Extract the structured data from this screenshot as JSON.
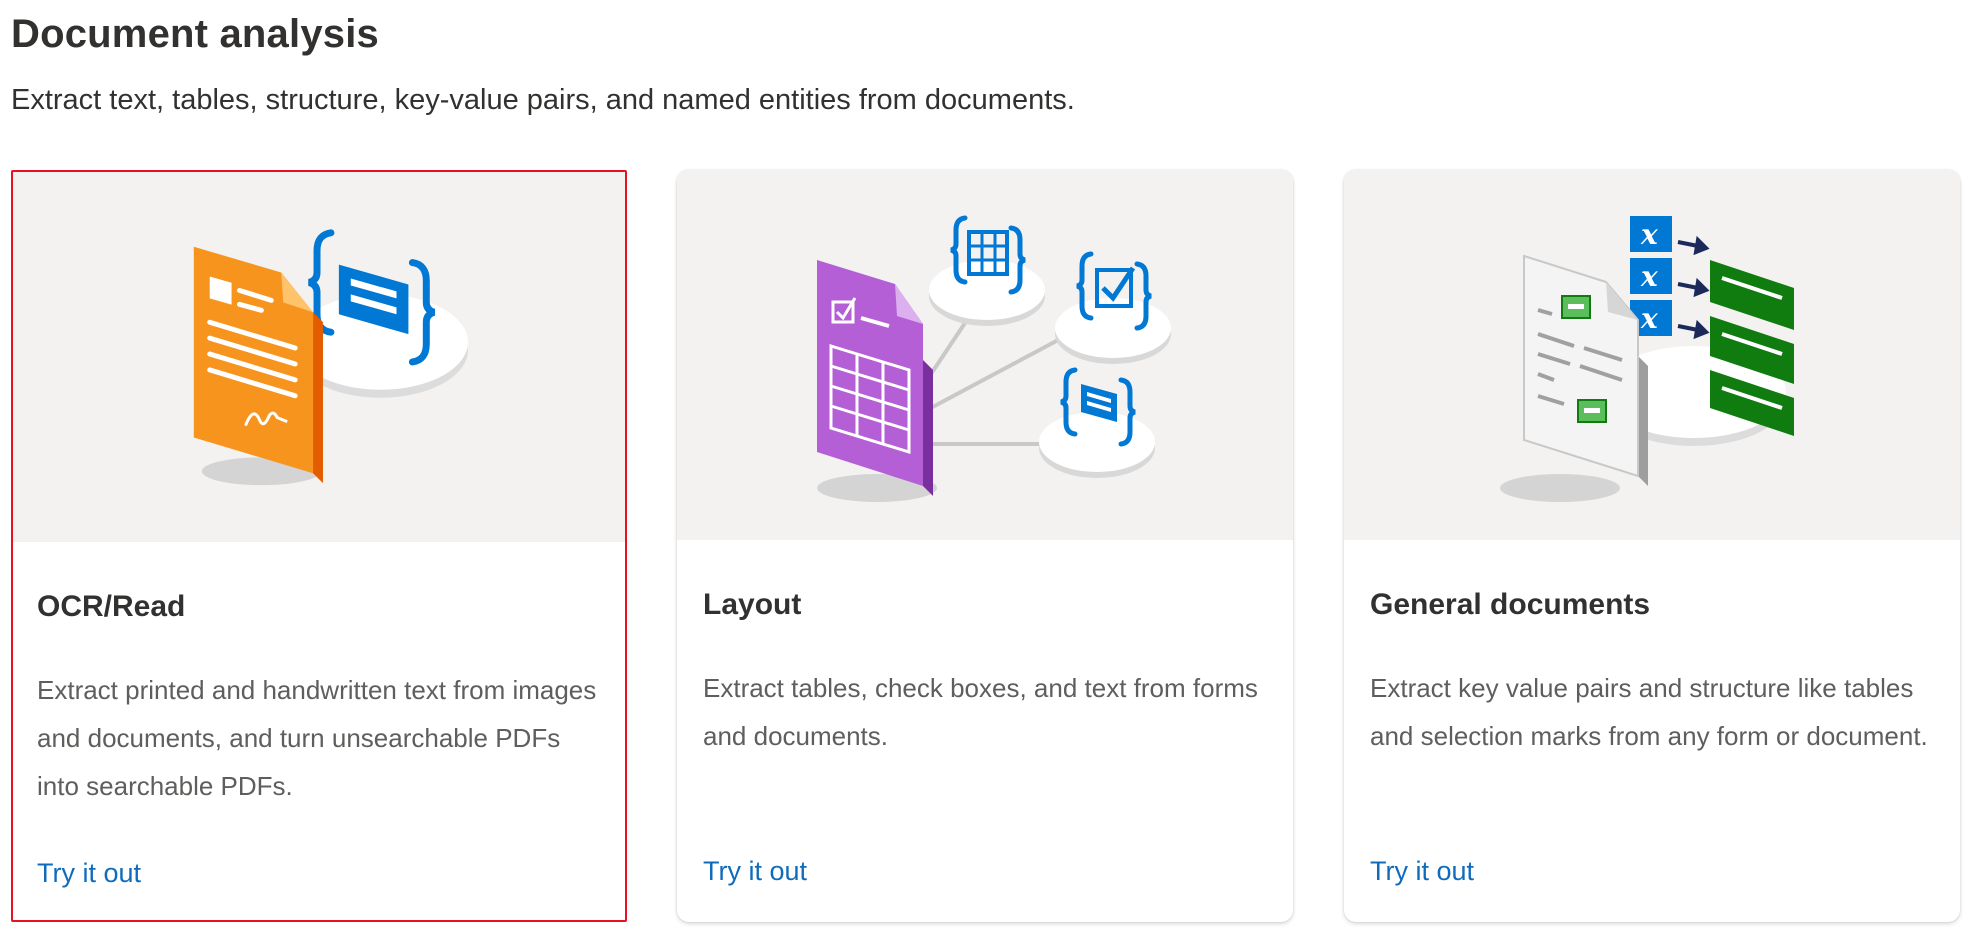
{
  "header": {
    "title": "Document analysis",
    "subtitle": "Extract text, tables, structure, key-value pairs, and named entities from documents."
  },
  "cards": [
    {
      "title": "OCR/Read",
      "description": "Extract printed and handwritten text from images and documents, and turn unsearchable PDFs into searchable PDFs.",
      "link": "Try it out",
      "icon": "ocr-document-illustration",
      "selected": true
    },
    {
      "title": "Layout",
      "description": "Extract tables, check boxes, and text from forms and documents.",
      "link": "Try it out",
      "icon": "layout-document-illustration",
      "selected": false
    },
    {
      "title": "General documents",
      "description": "Extract key value pairs and structure like tables and selection marks from any form or document.",
      "link": "Try it out",
      "icon": "general-document-illustration",
      "selected": false
    }
  ],
  "colors": {
    "link": "#0f6cbd",
    "selection_border": "#e81123",
    "ocr_orange": "#f7941d",
    "layout_purple": "#a855c9",
    "entity_blue": "#0078d4",
    "entity_green": "#107c10"
  }
}
